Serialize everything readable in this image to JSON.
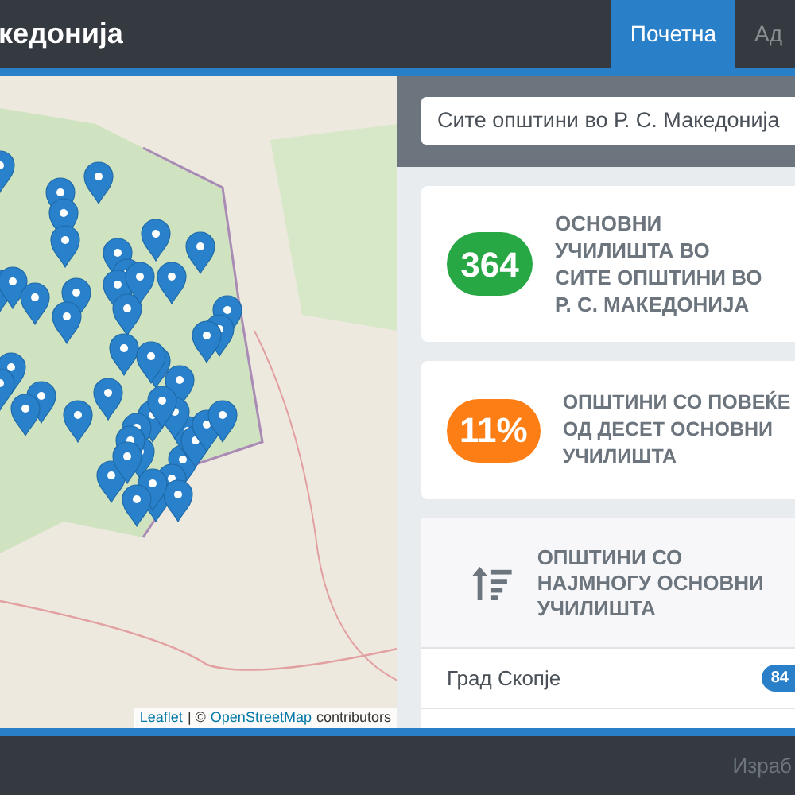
{
  "navbar": {
    "brand": "кедонија",
    "links": [
      {
        "label": "Почетна",
        "selected": true
      },
      {
        "label": "Ад",
        "selected": false
      }
    ]
  },
  "map": {
    "attribution_link_1": "Leaflet",
    "attribution_separator": "| ©",
    "attribution_link_2": "OpenStreetMap",
    "attribution_text": "contributors"
  },
  "filter": {
    "value": "Сите општини во Р. С. Македонија"
  },
  "stats": [
    {
      "kind": "badge",
      "value": "364",
      "color": "#28a745",
      "text": "ОСНОВНИ УЧИЛИШТА ВО СИТЕ ОПШТИНИ ВО Р. С. МАКЕДОНИЈА"
    },
    {
      "kind": "badge",
      "value": "11%",
      "color": "#fd7e14",
      "text": "ОПШТИНИ СО ПОВЕЌЕ ОД ДЕСЕТ ОСНОВНИ УЧИЛИШТА"
    }
  ],
  "ranking": {
    "title": "ОПШТИНИ СО НАЈМНОГУ ОСНОВНИ УЧИЛИШТА",
    "items": [
      {
        "name": "Град Скопје",
        "count": "84"
      }
    ]
  },
  "footer": {
    "text": "Израб"
  }
}
